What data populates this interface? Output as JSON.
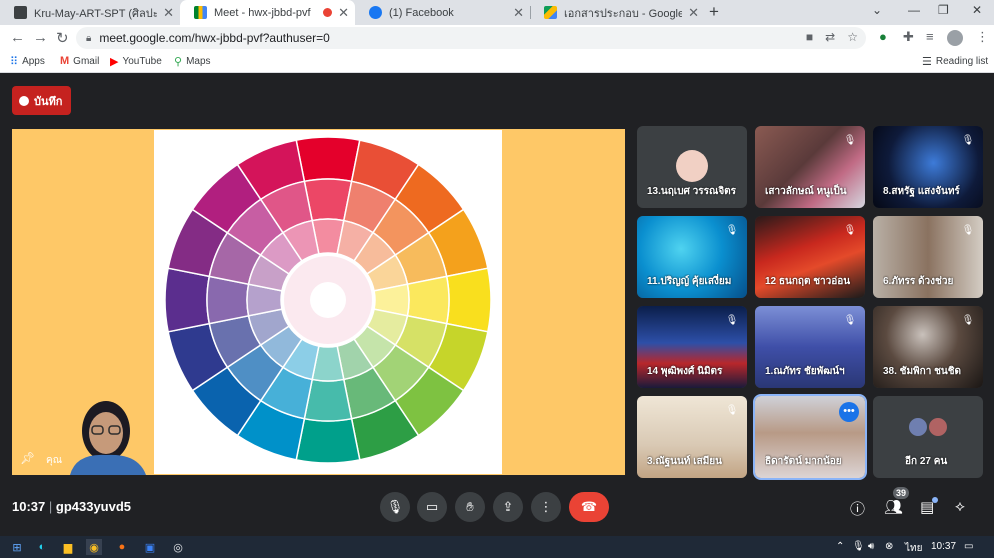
{
  "browser": {
    "tabs": [
      {
        "title": "Kru-May-ART-SPT (ศิลปะ-ทัศนศิลป์",
        "close": "✕"
      },
      {
        "title": "Meet - hwx-jbbd-pvf",
        "close": "✕"
      },
      {
        "title": "(1) Facebook",
        "close": "✕"
      },
      {
        "title": "เอกสารประกอบ - Google ไดรฟ์",
        "close": "✕"
      }
    ],
    "new_tab": "+",
    "url": "meet.google.com/hwx-jbbd-pvf?authuser=0",
    "bookmarks": [
      {
        "label": "Apps"
      },
      {
        "label": "Gmail"
      },
      {
        "label": "YouTube"
      },
      {
        "label": "Maps"
      }
    ],
    "reading_list": "Reading list"
  },
  "meet": {
    "record_label": "บันทึก",
    "self_name": "คุณ",
    "meeting_time": "10:37",
    "meeting_code": "gp433yuvd5",
    "participants_count": "39",
    "tiles": [
      {
        "name": "13.นฤเบศ วรรณจิตร"
      },
      {
        "name": "เสาวลักษณ์ หนูเป็น"
      },
      {
        "name": "8.สหรัฐ แสงจันทร์"
      },
      {
        "name": "11.ปริญญ์ คุ้ยเสงี่ยม"
      },
      {
        "name": "12 ธนกฤต ชาวอ่อน"
      },
      {
        "name": "6.ภัทรร ด้วงช่วย"
      },
      {
        "name": "14 พุฒิพงศ์ นิมิตร"
      },
      {
        "name": "1.ณภัทร ชัยพัฒน์ฯ"
      },
      {
        "name": "38. ชัมพิกา ชนชิด"
      },
      {
        "name": "3.ณัฐนนท์ เสมียน"
      },
      {
        "name": "ธิดารัตน์ มากน้อย"
      },
      {
        "name": "อีก 27 คน"
      }
    ]
  },
  "taskbar": {
    "language": "ไทย",
    "clock": "10:37"
  },
  "colors": {
    "meet_bg": "#202124",
    "record_red": "#c5221f",
    "hangup_red": "#ea4335",
    "slide_bg": "#fec867"
  },
  "color_wheel": {
    "outer": [
      "#e4002b",
      "#e94f36",
      "#ee6a20",
      "#f4a11c",
      "#f9df1e",
      "#c6d52a",
      "#7ec241",
      "#2d9e45",
      "#00a08b",
      "#0091c9",
      "#0a63ae",
      "#2f3a8f",
      "#5b2e8e",
      "#842c85",
      "#b11f7f",
      "#d4145a"
    ]
  }
}
